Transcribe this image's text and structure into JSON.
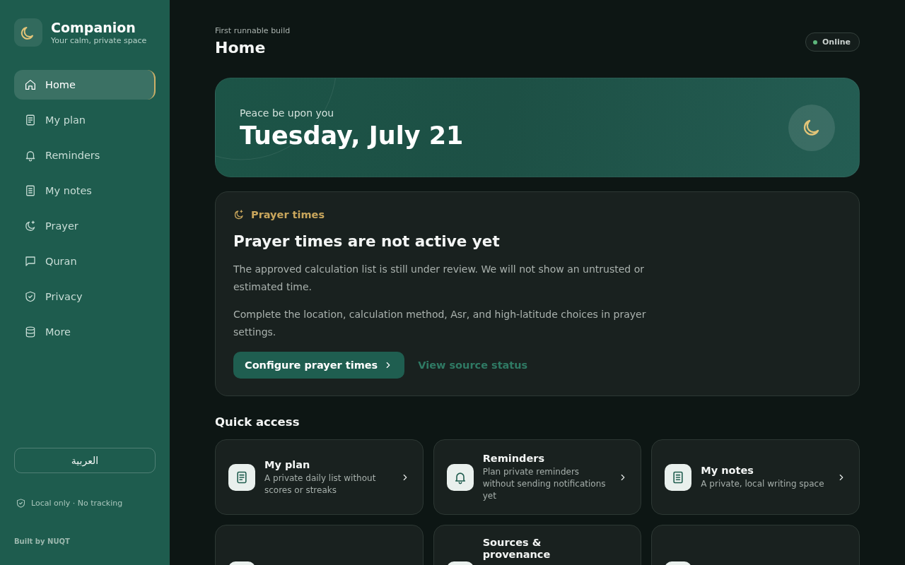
{
  "sidebar": {
    "brand": {
      "name": "Companion",
      "tagline": "Your calm, private space"
    },
    "nav": [
      {
        "label": "Home",
        "kind": "home",
        "selected": true
      },
      {
        "label": "My plan",
        "kind": "plan",
        "selected": false
      },
      {
        "label": "Reminders",
        "kind": "reminders",
        "selected": false
      },
      {
        "label": "My notes",
        "kind": "notes",
        "selected": false
      },
      {
        "label": "Prayer",
        "kind": "prayer",
        "selected": false
      },
      {
        "label": "Quran",
        "kind": "quran",
        "selected": false
      },
      {
        "label": "Privacy",
        "kind": "privacy",
        "selected": false
      },
      {
        "label": "More",
        "kind": "more",
        "selected": false
      }
    ],
    "language_button": "العربية",
    "privacy_note": "Local only · No tracking",
    "credit": "Built by NUQT"
  },
  "header": {
    "eyebrow": "First runnable build",
    "title": "Home",
    "status": {
      "label": "Online",
      "online": true
    }
  },
  "hero": {
    "greeting": "Peace be upon you",
    "date": "Tuesday, July 21"
  },
  "prayer_card": {
    "eyebrow": "Prayer times",
    "title": "Prayer times are not active yet",
    "paragraphs": [
      "The approved calculation list is still under review. We will not show an untrusted or estimated time.",
      "Complete the location, calculation method, Asr, and high-latitude choices in prayer settings."
    ],
    "primary_button": "Configure prayer times",
    "link": "View source status"
  },
  "quick_access": {
    "title": "Quick access",
    "cards": [
      {
        "kind": "plan",
        "title": "My plan",
        "description": "A private daily list without scores or streaks"
      },
      {
        "kind": "reminders",
        "title": "Reminders",
        "description": "Plan private reminders without sending notifications yet"
      },
      {
        "kind": "notes",
        "title": "My notes",
        "description": "A private, local writing space"
      },
      {
        "cut_off": true
      },
      {
        "title": "Sources & provenance",
        "cut_off": true
      },
      {
        "cut_off": true
      }
    ]
  }
}
